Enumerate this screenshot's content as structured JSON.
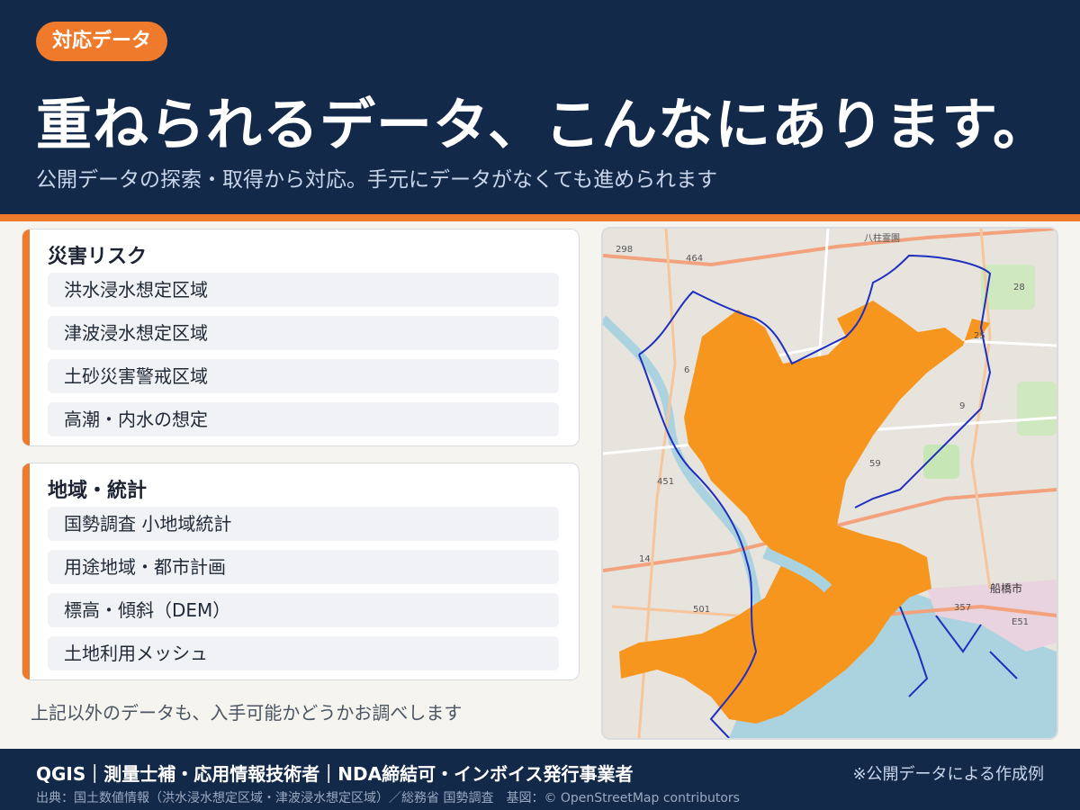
{
  "header": {
    "badge": "対応データ",
    "title": "重ねられるデータ、こんなにあります。",
    "subtitle": "公開データの探索・取得から対応。手元にデータがなくても進められます"
  },
  "cards": [
    {
      "title": "災害リスク",
      "items": [
        "洪水浸水想定区域",
        "津波浸水想定区域",
        "土砂災害警戒区域",
        "高潮・内水の想定"
      ]
    },
    {
      "title": "地域・統計",
      "items": [
        "国勢調査 小地域統計",
        "用途地域・都市計画",
        "標高・傾斜（DEM）",
        "土地利用メッシュ"
      ]
    }
  ],
  "note": "上記以外のデータも、入手可能かどうかお調べします",
  "map": {
    "labels": [
      "298",
      "464",
      "八柱霊園",
      "28",
      "25",
      "9",
      "59",
      "451",
      "14",
      "501",
      "357",
      "E51",
      "船橋市",
      "6"
    ],
    "colors": {
      "flood_area": "#f7961f",
      "boundary": "#1f2fc0",
      "water": "#aad3df",
      "road": "#f2a37e"
    }
  },
  "footer": {
    "main": "QGIS｜測量士補・応用情報技術者｜NDA締結可・インボイス発行事業者",
    "right": "※公開データによる作成例",
    "source": "出典：国土数値情報（洪水浸水想定区域・津波浸水想定区域）／総務省 国勢調査　基図：© OpenStreetMap contributors"
  },
  "colors": {
    "navy": "#13294a",
    "accent": "#f07a2b"
  }
}
